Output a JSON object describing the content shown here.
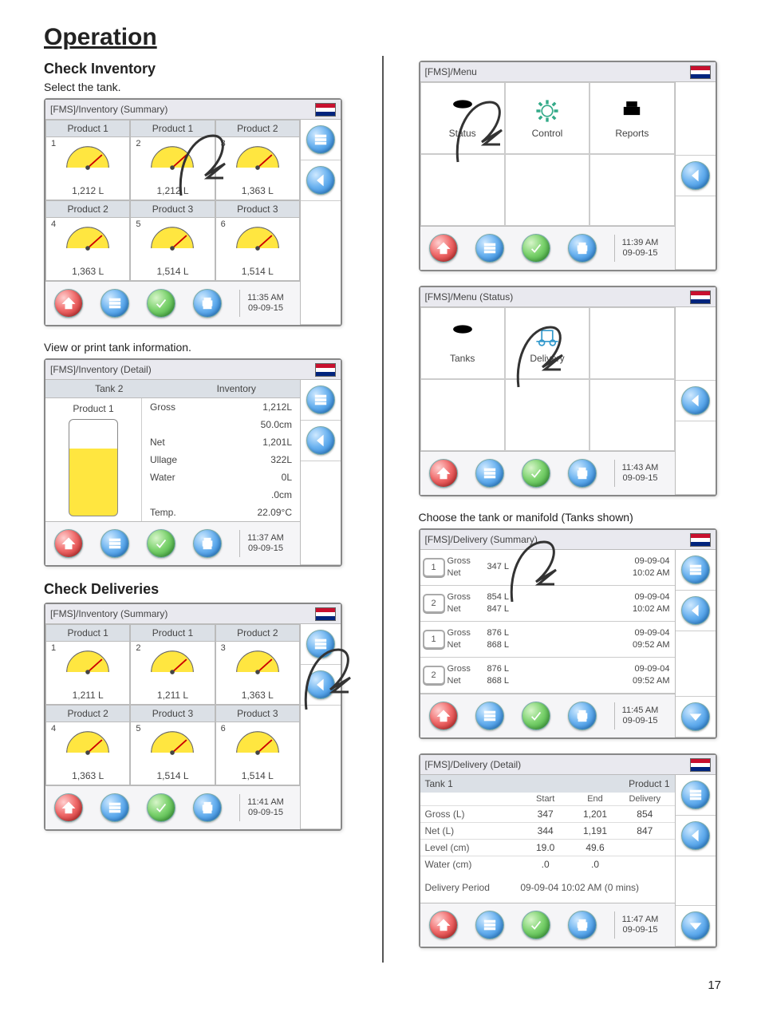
{
  "page_number": "17",
  "headings": {
    "operation": "Operation",
    "check_inventory": "Check Inventory",
    "check_deliveries": "Check Deliveries"
  },
  "captions": {
    "select_tank": "Select the tank.",
    "view_or_print": "View or print tank information.",
    "choose_tank_or_manifold": "Choose the tank or manifold (Tanks shown)"
  },
  "inv_summary_1": {
    "title": "[FMS]/Inventory (Summary)",
    "cells": [
      {
        "hdr": "Product 1",
        "num": "1",
        "val": "1,212 L"
      },
      {
        "hdr": "Product 1",
        "num": "2",
        "val": "1,212 L"
      },
      {
        "hdr": "Product 2",
        "num": "3",
        "val": "1,363 L"
      },
      {
        "hdr": "Product 2",
        "num": "4",
        "val": "1,363 L"
      },
      {
        "hdr": "Product 3",
        "num": "5",
        "val": "1,514 L"
      },
      {
        "hdr": "Product 3",
        "num": "6",
        "val": "1,514 L"
      }
    ],
    "time": "11:35 AM",
    "date": "09-09-15"
  },
  "inv_detail": {
    "title": "[FMS]/Inventory (Detail)",
    "tank_label": "Tank 2",
    "inventory_label": "Inventory",
    "product": "Product 1",
    "rows": [
      {
        "k": "Gross",
        "v": "1,212L"
      },
      {
        "k": "",
        "v": "50.0cm"
      },
      {
        "k": "Net",
        "v": "1,201L"
      },
      {
        "k": "Ullage",
        "v": "322L"
      },
      {
        "k": "Water",
        "v": "0L"
      },
      {
        "k": "",
        "v": ".0cm"
      },
      {
        "k": "Temp.",
        "v": "22.09°C"
      }
    ],
    "time": "11:37 AM",
    "date": "09-09-15"
  },
  "inv_summary_2": {
    "title": "[FMS]/Inventory (Summary)",
    "cells": [
      {
        "hdr": "Product 1",
        "num": "1",
        "val": "1,211 L"
      },
      {
        "hdr": "Product 1",
        "num": "2",
        "val": "1,211 L"
      },
      {
        "hdr": "Product 2",
        "num": "3",
        "val": "1,363 L"
      },
      {
        "hdr": "Product 2",
        "num": "4",
        "val": "1,363 L"
      },
      {
        "hdr": "Product 3",
        "num": "5",
        "val": "1,514 L"
      },
      {
        "hdr": "Product 3",
        "num": "6",
        "val": "1,514 L"
      }
    ],
    "time": "11:41 AM",
    "date": "09-09-15"
  },
  "menu": {
    "title": "[FMS]/Menu",
    "items": [
      "Status",
      "Control",
      "Reports"
    ],
    "time": "11:39 AM",
    "date": "09-09-15"
  },
  "menu_status": {
    "title": "[FMS]/Menu (Status)",
    "items": [
      "Tanks",
      "Delivery"
    ],
    "time": "11:43 AM",
    "date": "09-09-15"
  },
  "deliv_summary": {
    "title": "[FMS]/Delivery (Summary)",
    "rows": [
      {
        "tag": "1",
        "gross_lbl": "Gross",
        "net_lbl": "Net",
        "gross": "",
        "net": "347 L",
        "date": "09-09-04",
        "time": "10:02 AM"
      },
      {
        "tag": "2",
        "gross_lbl": "Gross",
        "net_lbl": "Net",
        "gross": "854 L",
        "net": "847 L",
        "date": "09-09-04",
        "time": "10:02 AM"
      },
      {
        "tag": "1",
        "gross_lbl": "Gross",
        "net_lbl": "Net",
        "gross": "876 L",
        "net": "868 L",
        "date": "09-09-04",
        "time": "09:52 AM"
      },
      {
        "tag": "2",
        "gross_lbl": "Gross",
        "net_lbl": "Net",
        "gross": "876 L",
        "net": "868 L",
        "date": "09-09-04",
        "time": "09:52 AM"
      }
    ],
    "time": "11:45 AM",
    "date": "09-09-15"
  },
  "deliv_detail": {
    "title": "[FMS]/Delivery (Detail)",
    "tank": "Tank 1",
    "product": "Product 1",
    "th": {
      "start": "Start",
      "end": "End",
      "delivery": "Delivery"
    },
    "rows": [
      {
        "lab": "Gross (L)",
        "a": "347",
        "b": "1,201",
        "c": "854"
      },
      {
        "lab": "Net (L)",
        "a": "344",
        "b": "1,191",
        "c": "847"
      },
      {
        "lab": "Level (cm)",
        "a": "19.0",
        "b": "49.6",
        "c": ""
      },
      {
        "lab": "Water (cm)",
        "a": ".0",
        "b": ".0",
        "c": ""
      }
    ],
    "period_lbl": "Delivery Period",
    "period_val": "09-09-04 10:02 AM (0 mins)",
    "time": "11:47 AM",
    "date": "09-09-15"
  },
  "icons": {
    "list": "list-icon",
    "back": "back-arrow-icon",
    "home": "home-icon",
    "alarm": "alarm-icon",
    "check": "check-icon",
    "print": "print-icon",
    "down": "down-arrow-icon"
  }
}
